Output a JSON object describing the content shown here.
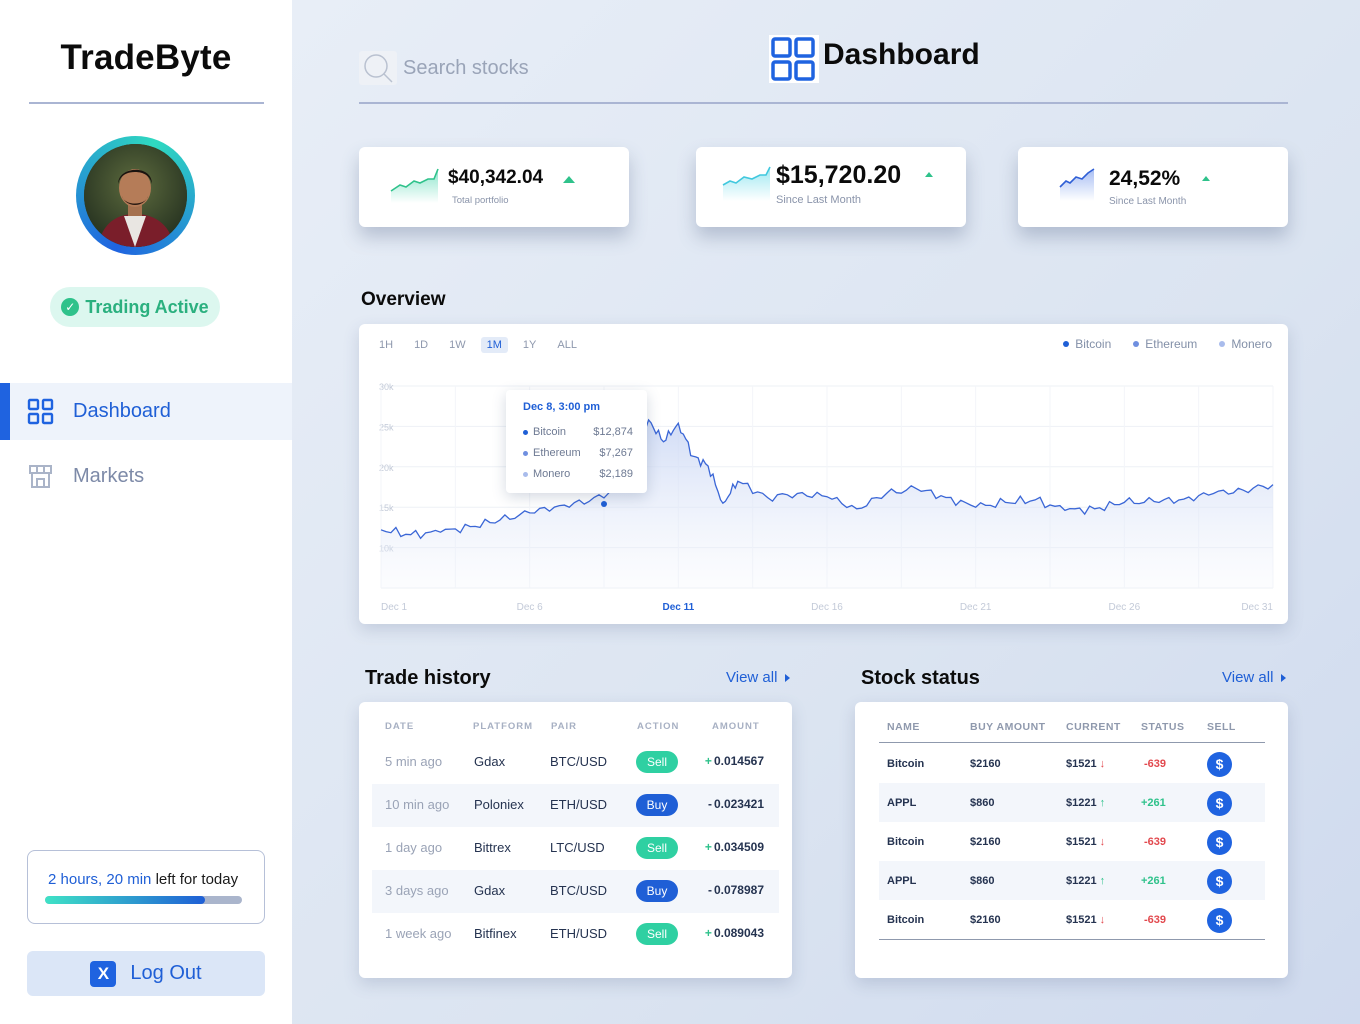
{
  "app": {
    "brand": "TradeByte"
  },
  "sidebar": {
    "status": "Trading Active",
    "nav": [
      {
        "label": "Dashboard",
        "icon": "grid-icon",
        "active": true
      },
      {
        "label": "Markets",
        "icon": "store-icon",
        "active": false
      }
    ],
    "time_left": {
      "highlight": "2 hours, 20 min",
      "rest": "left for today",
      "progress": 0.81
    },
    "logout": {
      "label": "Log Out",
      "icon": "x-icon"
    }
  },
  "header": {
    "search_placeholder": "Search stocks",
    "title": "Dashboard"
  },
  "stats": [
    {
      "value": "$40,342.04",
      "label": "Total portfolio"
    },
    {
      "value": "$15,720.20",
      "label": "Since Last Month"
    },
    {
      "value": "24,52%",
      "label": "Since Last Month"
    }
  ],
  "overview": {
    "title": "Overview",
    "ranges": [
      "1H",
      "1D",
      "1W",
      "1M",
      "1Y",
      "ALL"
    ],
    "active_range": "1M",
    "legend": [
      "Bitcoin",
      "Ethereum",
      "Monero"
    ],
    "tooltip": {
      "title": "Dec 8, 3:00 pm",
      "rows": [
        {
          "name": "Bitcoin",
          "value": "$12,874"
        },
        {
          "name": "Ethereum",
          "value": "$7,267"
        },
        {
          "name": "Monero",
          "value": "$2,189"
        }
      ]
    }
  },
  "chart_data": {
    "type": "area",
    "y_ticks": [
      "30k",
      "25k",
      "20k",
      "15k",
      "10k"
    ],
    "ylim": [
      5000,
      30000
    ],
    "x_ticks": [
      "Dec 1",
      "Dec 6",
      "Dec 11",
      "Dec 16",
      "Dec 21",
      "Dec 26",
      "Dec 31"
    ],
    "active_x_tick": "Dec 11",
    "grid": true,
    "series": [
      {
        "name": "Bitcoin",
        "x": [
          1,
          2,
          3,
          4,
          5,
          6,
          7,
          8,
          9,
          10,
          10.5,
          11,
          11.5,
          12,
          12.5,
          13,
          14,
          15,
          16,
          17,
          18,
          19,
          20,
          21,
          22,
          23,
          24,
          25,
          26,
          27,
          28,
          29,
          30,
          31
        ],
        "y": [
          12200,
          11600,
          11900,
          12600,
          13400,
          14300,
          15200,
          15700,
          17400,
          25800,
          23100,
          25400,
          21300,
          20100,
          15500,
          18200,
          16200,
          16700,
          16300,
          14800,
          16700,
          17300,
          16200,
          15000,
          15600,
          15900,
          14600,
          14800,
          15600,
          15700,
          16000,
          16700,
          17100,
          17800
        ]
      }
    ],
    "highlight_point": {
      "x": 8.5,
      "y": 15400
    }
  },
  "trade_history": {
    "title": "Trade history",
    "view_all": "View all",
    "columns": [
      "DATE",
      "PLATFORM",
      "PAIR",
      "ACTION",
      "AMOUNT"
    ],
    "rows": [
      {
        "date": "5 min ago",
        "platform": "Gdax",
        "pair": "BTC/USD",
        "action": "Sell",
        "sign": "+",
        "amount": "0.014567"
      },
      {
        "date": "10 min ago",
        "platform": "Poloniex",
        "pair": "ETH/USD",
        "action": "Buy",
        "sign": "-",
        "amount": "0.023421"
      },
      {
        "date": "1 day ago",
        "platform": "Bittrex",
        "pair": "LTC/USD",
        "action": "Sell",
        "sign": "+",
        "amount": "0.034509"
      },
      {
        "date": "3 days ago",
        "platform": "Gdax",
        "pair": "BTC/USD",
        "action": "Buy",
        "sign": "-",
        "amount": "0.078987"
      },
      {
        "date": "1 week ago",
        "platform": "Bitfinex",
        "pair": "ETH/USD",
        "action": "Sell",
        "sign": "+",
        "amount": "0.089043"
      }
    ]
  },
  "stock_status": {
    "title": "Stock status",
    "view_all": "View all",
    "columns": [
      "NAME",
      "BUY AMOUNT",
      "CURRENT",
      "STATUS",
      "SELL"
    ],
    "rows": [
      {
        "name": "Bitcoin",
        "buy": "$2160",
        "current": "$1521",
        "dir": "down",
        "status": "-639"
      },
      {
        "name": "APPL",
        "buy": "$860",
        "current": "$1221",
        "dir": "up",
        "status": "+261"
      },
      {
        "name": "Bitcoin",
        "buy": "$2160",
        "current": "$1521",
        "dir": "down",
        "status": "-639"
      },
      {
        "name": "APPL",
        "buy": "$860",
        "current": "$1221",
        "dir": "up",
        "status": "+261"
      },
      {
        "name": "Bitcoin",
        "buy": "$2160",
        "current": "$1521",
        "dir": "down",
        "status": "-639"
      }
    ],
    "sell_icon": "dollar-icon"
  },
  "colors": {
    "accent": "#1f63e0",
    "positive": "#2fc28b",
    "negative": "#e2494e",
    "teal": "#2fd0a2"
  }
}
